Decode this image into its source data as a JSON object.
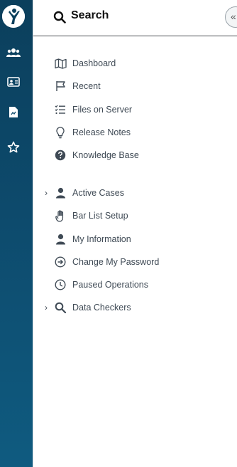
{
  "header": {
    "title": "Search"
  },
  "rail": {
    "icons": [
      "users-icon",
      "id-card-icon",
      "document-icon",
      "star-icon"
    ]
  },
  "menu": {
    "groups": [
      [
        {
          "label": "Dashboard",
          "icon": "map-icon"
        },
        {
          "label": "Recent",
          "icon": "flag-icon"
        },
        {
          "label": "Files on Server",
          "icon": "checklist-icon"
        },
        {
          "label": "Release Notes",
          "icon": "lightbulb-icon"
        },
        {
          "label": "Knowledge Base",
          "icon": "question-circle-icon"
        }
      ],
      [
        {
          "label": "Active Cases",
          "icon": "user-icon",
          "expandable": true
        },
        {
          "label": "Bar List Setup",
          "icon": "hand-icon"
        },
        {
          "label": "My Information",
          "icon": "user-icon"
        },
        {
          "label": "Change My Password",
          "icon": "arrow-circle-icon"
        },
        {
          "label": "Paused Operations",
          "icon": "clock-icon"
        },
        {
          "label": "Data Checkers",
          "icon": "search-icon",
          "expandable": true
        }
      ]
    ]
  },
  "colors": {
    "rail": "#0d4a6c",
    "text": "#3f4a55",
    "accent": "#0b3f5c"
  }
}
